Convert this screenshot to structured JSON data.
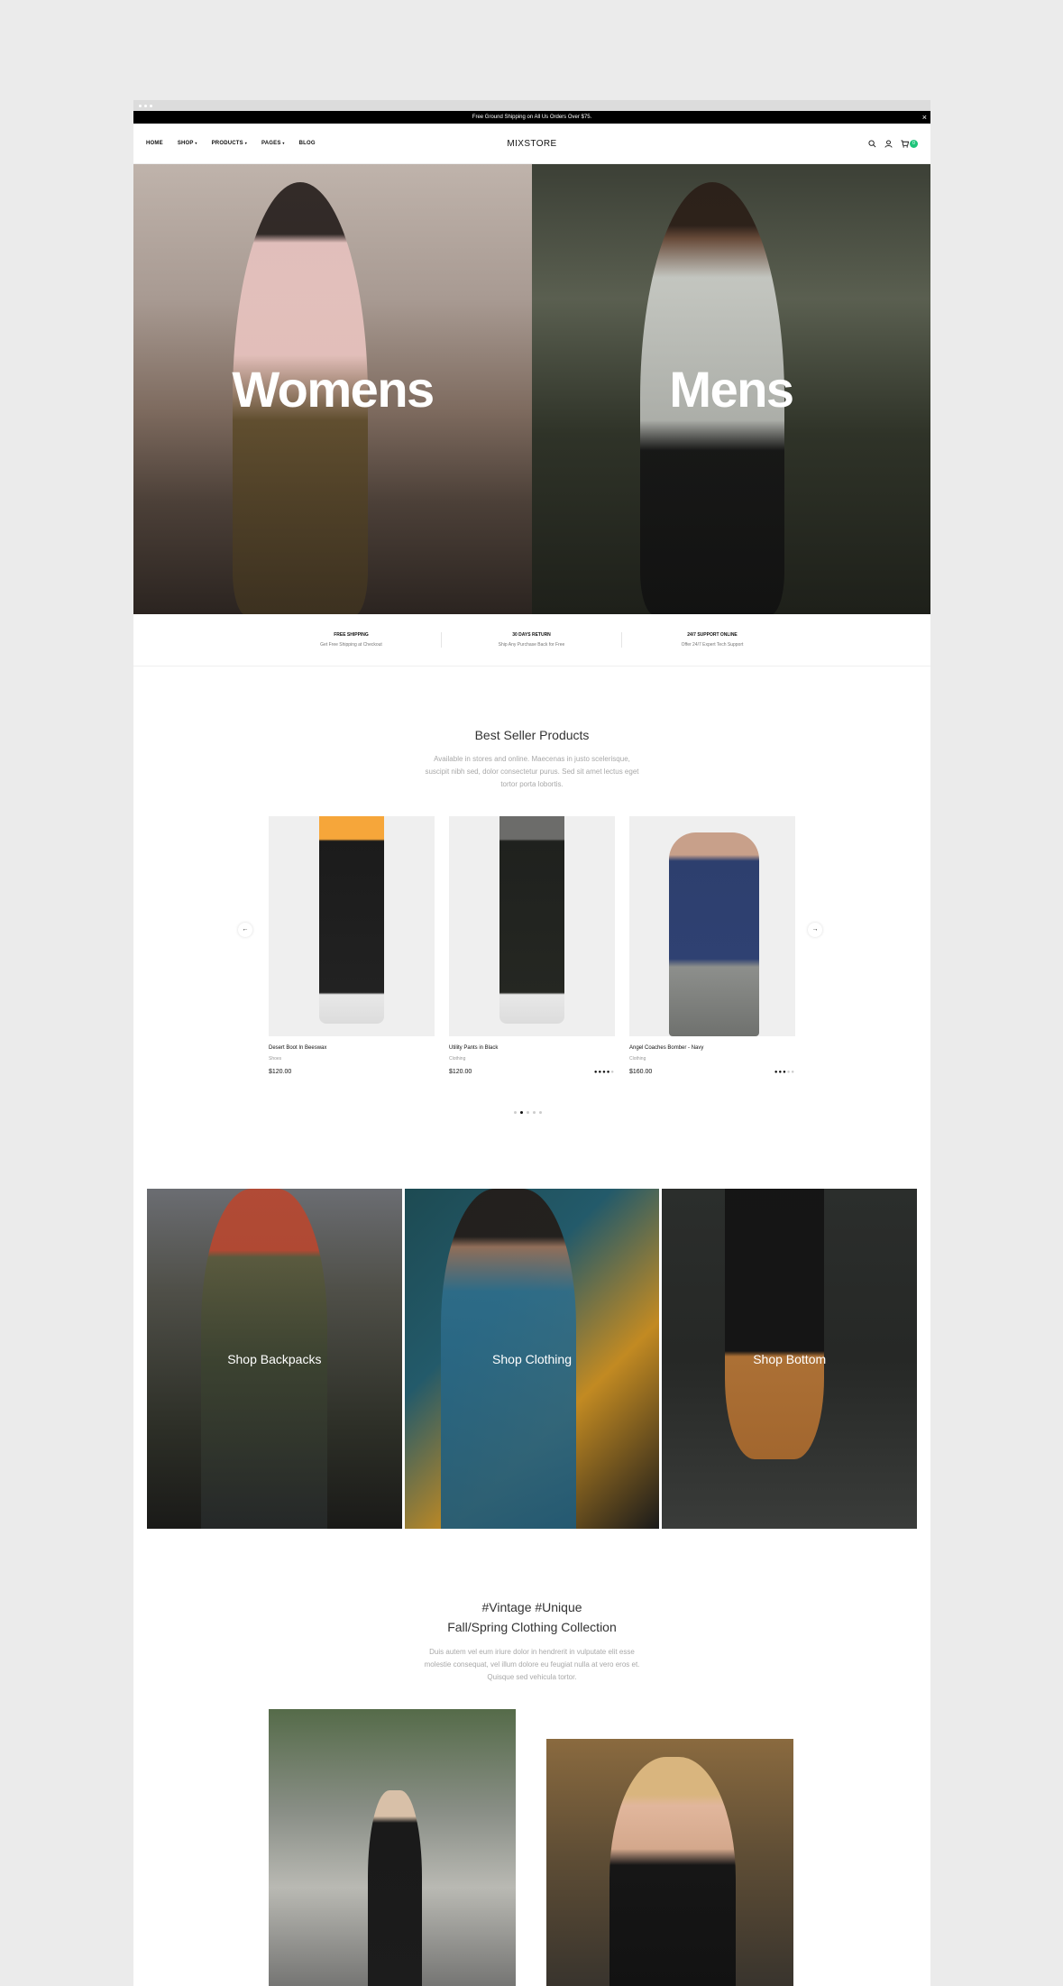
{
  "announcement": {
    "text": "Free Ground Shipping on All Us Orders Over $75.",
    "close": "×"
  },
  "nav": {
    "menu": [
      "HOME",
      "SHOP",
      "PRODUCTS",
      "PAGES",
      "BLOG"
    ],
    "dropdown_marks": [
      "",
      "▾",
      "▾",
      "▾",
      ""
    ],
    "logo": "MIXSTORE",
    "cart_count": "0"
  },
  "hero": {
    "left_label": "Womens",
    "right_label": "Mens"
  },
  "features": [
    {
      "title": "FREE SHIPPING",
      "subtitle": "Get Free Shipping at Checkout"
    },
    {
      "title": "30 DAYS RETURN",
      "subtitle": "Ship Any Purchase Back for Free"
    },
    {
      "title": "24/7 SUPPORT ONLINE",
      "subtitle": "Offer 24/7 Expert Tech Support"
    }
  ],
  "best_sellers": {
    "title": "Best Seller Products",
    "description": "Available in stores and online. Maecenas in justo scelerisque, suscipit nibh sed, dolor consectetur purus. Sed sit amet lectus eget tortor porta lobortis.",
    "products": [
      {
        "name": "Desert Boot In Beeswax",
        "category": "Shoes",
        "price": "$120.00",
        "rating": 0
      },
      {
        "name": "Utility Pants in Black",
        "category": "Clothing",
        "price": "$120.00",
        "rating": 4
      },
      {
        "name": "Angel Coaches Bomber - Navy",
        "category": "Clothing",
        "price": "$160.00",
        "rating": 3
      }
    ],
    "prev_arrow": "←",
    "next_arrow": "→",
    "page_count": 5,
    "active_page": 1
  },
  "categories": [
    "Shop Backpacks",
    "Shop Clothing",
    "Shop Bottom"
  ],
  "collection": {
    "title_line1": "#Vintage #Unique",
    "title_line2": "Fall/Spring Clothing Collection",
    "description": "Duis autem vel eum iriure dolor in hendrerit in vulputate elit esse molestie consequat, vel illum dolore eu feugiat nulla at vero eros et. Quisque sed vehicula tortor."
  }
}
